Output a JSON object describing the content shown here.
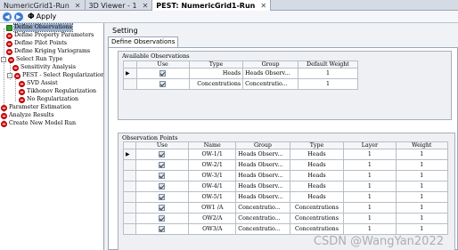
{
  "tabs": [
    {
      "label": "NumericGrid1-Run",
      "active": false
    },
    {
      "label": "3D Viewer - 1",
      "active": false
    },
    {
      "label": "PEST: NumericGrid1-Run",
      "active": true
    }
  ],
  "toolbar": {
    "apply_label": "Apply",
    "phi_symbol": "Φ"
  },
  "tree": [
    {
      "label": "Define Observations",
      "icon": "green",
      "selected": true
    },
    {
      "label": "Define Property Parameters",
      "icon": "red"
    },
    {
      "label": "Define Pilot Points",
      "icon": "red"
    },
    {
      "label": "Define Kriging Variograms",
      "icon": "red"
    },
    {
      "label": "Select Run Type",
      "icon": "red",
      "expand": "-"
    },
    {
      "label": "Sensitivity Analysis",
      "icon": "red"
    },
    {
      "label": "PEST - Select Regularization",
      "icon": "red",
      "expand": "-"
    },
    {
      "label": "SVD Assist",
      "icon": "red"
    },
    {
      "label": "Tikhonov Regularization",
      "icon": "red"
    },
    {
      "label": "No Regularization",
      "icon": "red"
    },
    {
      "label": "Parameter Estimation",
      "icon": "red"
    },
    {
      "label": "Analyze Results",
      "icon": "red"
    },
    {
      "label": "Create New Model Run",
      "icon": "red"
    }
  ],
  "setting_label": "Setting",
  "inner_tab": "Define Observations",
  "available": {
    "title": "Available Observations",
    "headers": [
      "Use",
      "Type",
      "Group",
      "Default Weight"
    ],
    "rows": [
      {
        "type": "Heads",
        "group": "Heads Observ...",
        "weight": "1",
        "use": true
      },
      {
        "type": "Concentrations",
        "group": "Concentratio...",
        "weight": "1",
        "use": true
      }
    ]
  },
  "points": {
    "title": "Observation Points",
    "headers": [
      "Use",
      "Name",
      "Group",
      "Type",
      "Layer",
      "Weight"
    ],
    "rows": [
      {
        "name": "OW-1/1",
        "group": "Heads Observ...",
        "type": "Heads",
        "layer": "1",
        "weight": "1",
        "use": true
      },
      {
        "name": "OW-2/1",
        "group": "Heads Observ...",
        "type": "Heads",
        "layer": "1",
        "weight": "1",
        "use": true
      },
      {
        "name": "OW-3/1",
        "group": "Heads Observ...",
        "type": "Heads",
        "layer": "1",
        "weight": "1",
        "use": true
      },
      {
        "name": "OW-4/1",
        "group": "Heads Observ...",
        "type": "Heads",
        "layer": "1",
        "weight": "1",
        "use": true
      },
      {
        "name": "OW-5/1",
        "group": "Heads Observ...",
        "type": "Heads",
        "layer": "1",
        "weight": "1",
        "use": true
      },
      {
        "name": "OW1 /A",
        "group": "Concentratio...",
        "type": "Concentrations",
        "layer": "1",
        "weight": "1",
        "use": true
      },
      {
        "name": "OW2/A",
        "group": "Concentratio...",
        "type": "Concentrations",
        "layer": "1",
        "weight": "1",
        "use": true
      },
      {
        "name": "OW3/A",
        "group": "Concentratio...",
        "type": "Concentrations",
        "layer": "1",
        "weight": "1",
        "use": true
      }
    ]
  },
  "watermark": "CSDN @WangYan2022"
}
